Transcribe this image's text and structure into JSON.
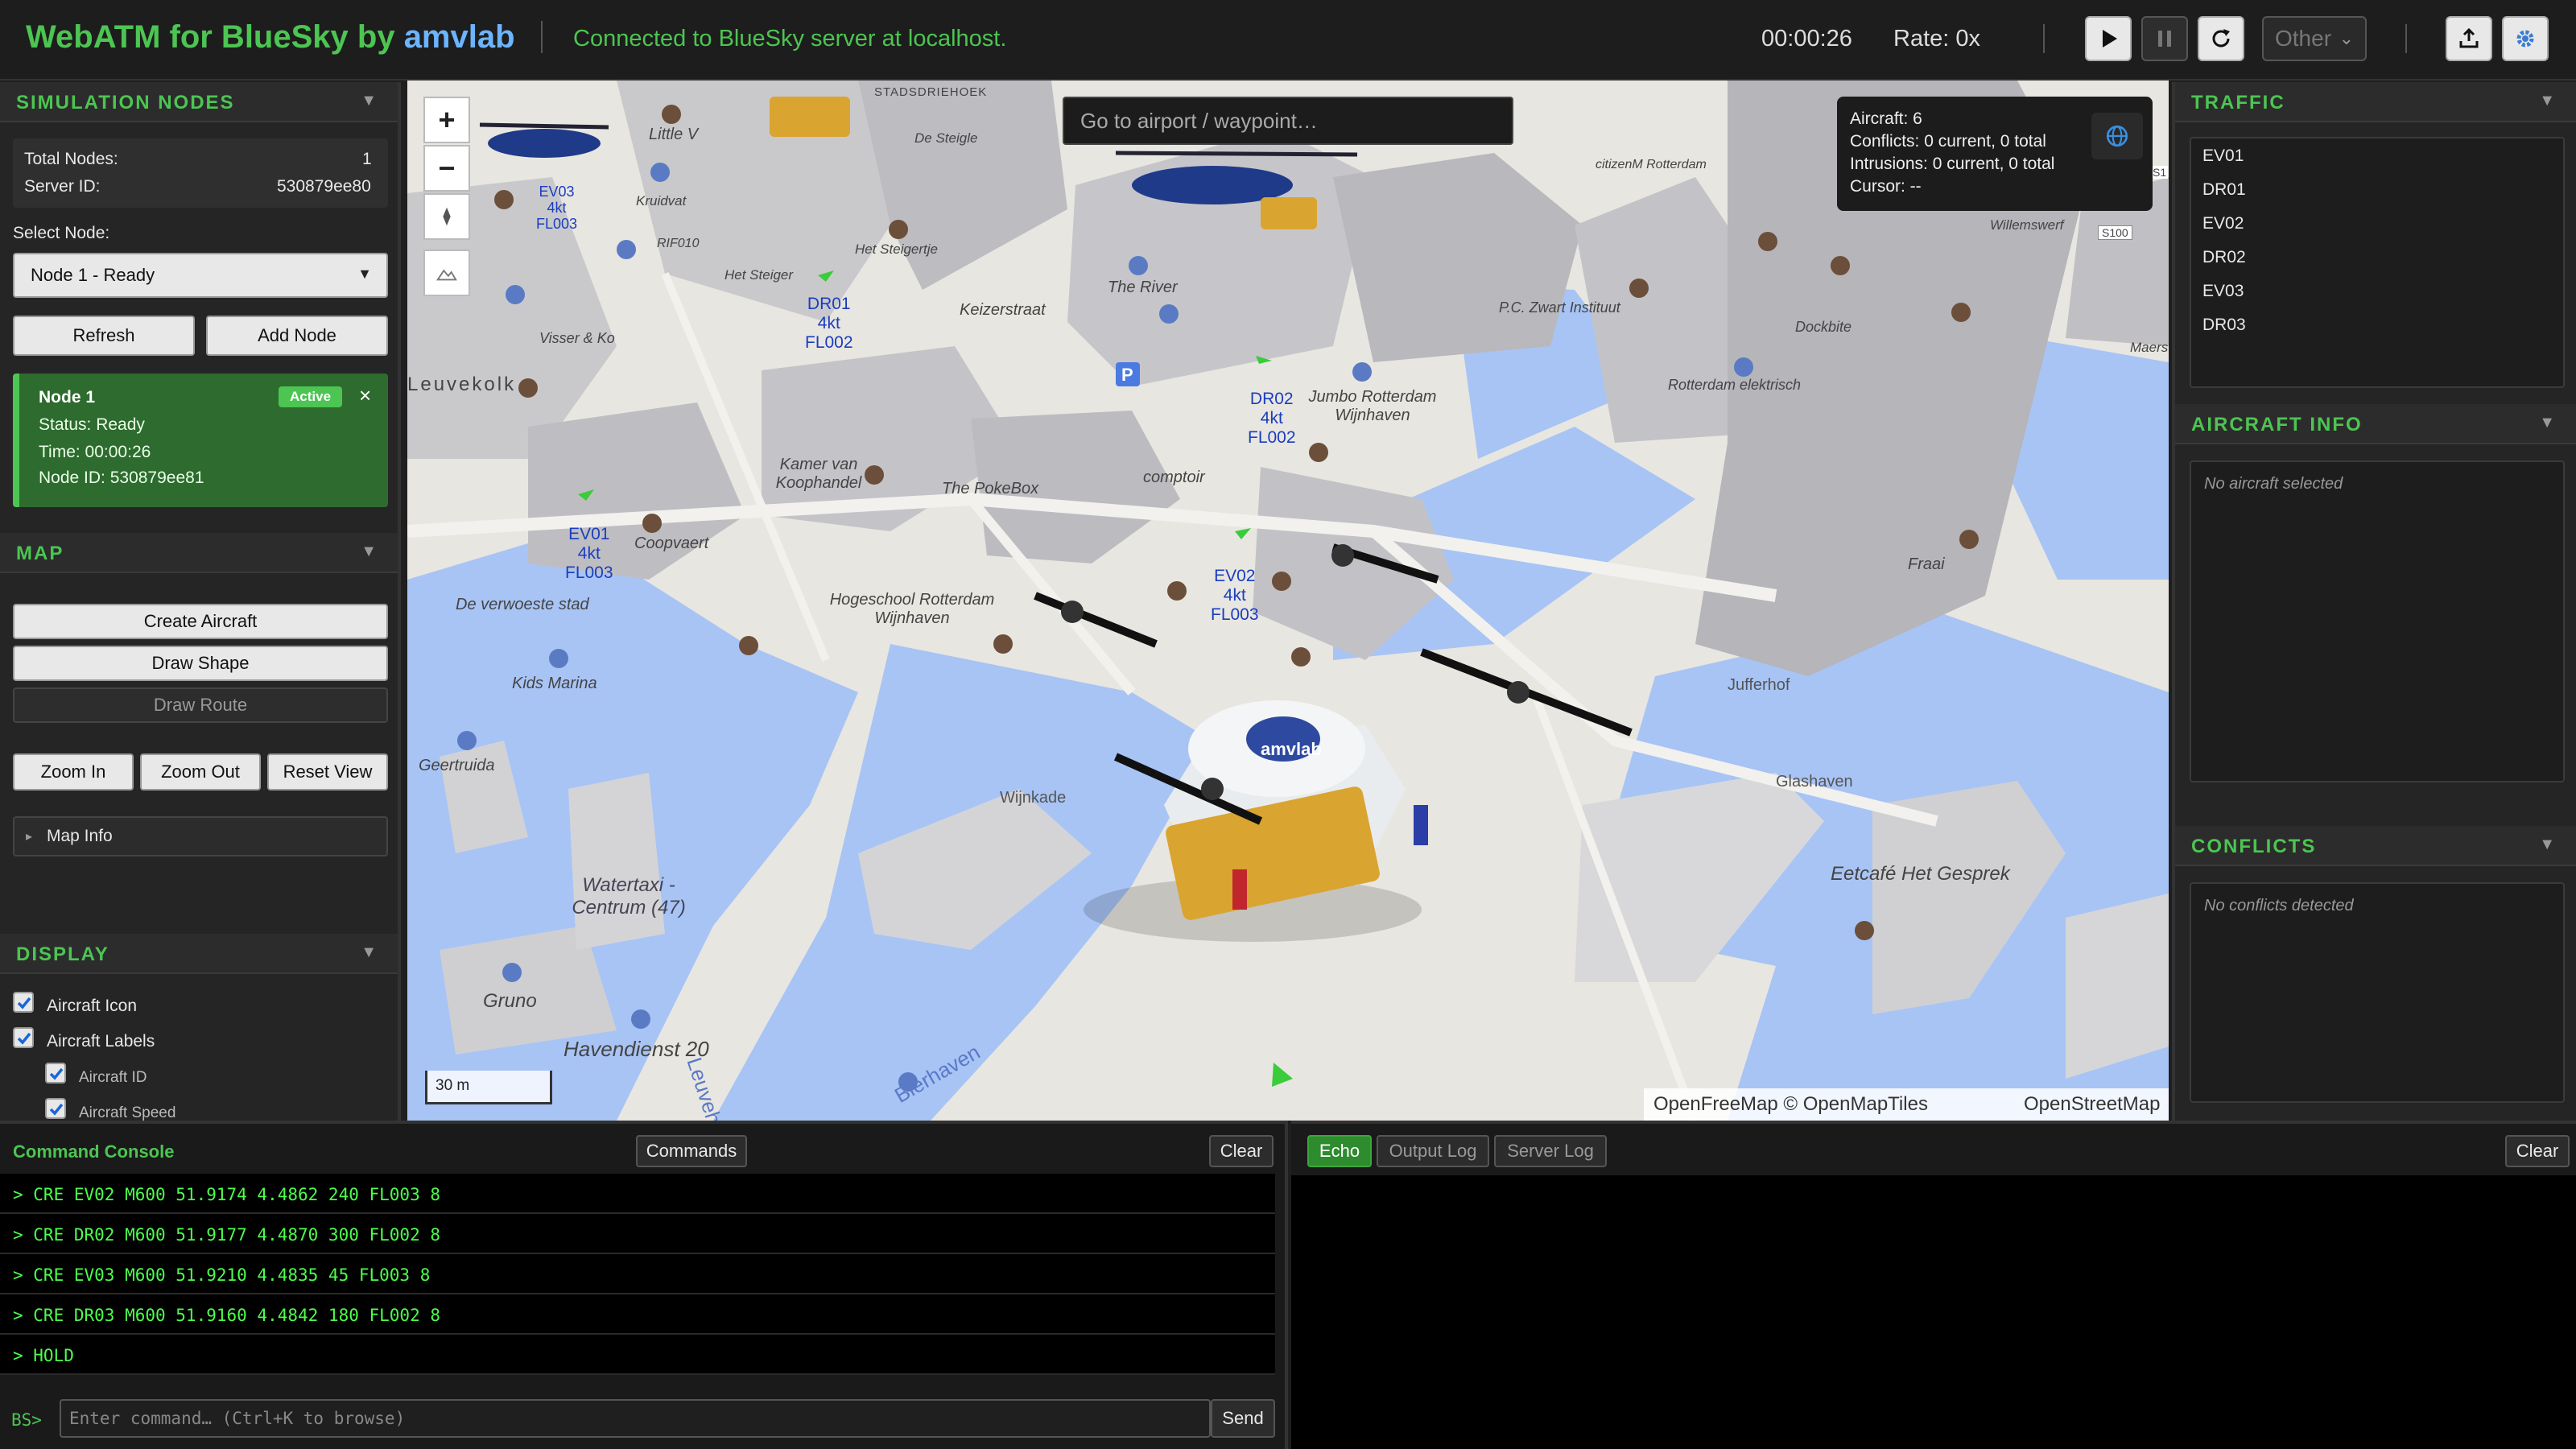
{
  "header": {
    "title_prefix": "WebATM for BlueSky by ",
    "title_brand": "amvlab",
    "connection_status": "Connected to BlueSky server at localhost.",
    "sim_time": "00:00:26",
    "rate": "Rate: 0x",
    "other_select": "Other"
  },
  "sim_nodes": {
    "section_title": "SIMULATION NODES",
    "total_nodes_label": "Total Nodes:",
    "total_nodes": "1",
    "server_id_label": "Server ID:",
    "server_id": "530879ee80",
    "select_label": "Select Node:",
    "selected_node": "Node 1 - Ready",
    "refresh_label": "Refresh",
    "add_label": "Add Node",
    "card": {
      "name": "Node 1",
      "badge": "Active",
      "close": "×",
      "status": "Status: Ready",
      "time": "Time: 00:00:26",
      "node_id": "Node ID: 530879ee81"
    }
  },
  "map_section": {
    "section_title": "MAP",
    "create_aircraft": "Create Aircraft",
    "draw_shape": "Draw Shape",
    "draw_route": "Draw Route",
    "zoom_in": "Zoom In",
    "zoom_out": "Zoom Out",
    "reset_view": "Reset View",
    "map_info": "Map Info"
  },
  "display": {
    "section_title": "DISPLAY",
    "options": [
      {
        "label": "Aircraft Icon",
        "checked": true
      },
      {
        "label": "Aircraft Labels",
        "checked": true
      },
      {
        "label": "Aircraft ID",
        "checked": true
      },
      {
        "label": "Aircraft Speed",
        "checked": true
      }
    ]
  },
  "map": {
    "search_placeholder": "Go to airport / waypoint…",
    "info": {
      "aircraft": "Aircraft: 6",
      "conflicts": "Conflicts: 0 current, 0 total",
      "intrusions": "Intrusions: 0 current, 0 total",
      "cursor": "Cursor: --"
    },
    "scale": "30 m",
    "attribution_a": "OpenFreeMap © OpenMapTiles",
    "attribution_b": "OpenStreetMap",
    "aircraft_labels": [
      {
        "id": "EV03",
        "speed": "4kt",
        "alt": "FL003"
      },
      {
        "id": "DR01",
        "speed": "4kt",
        "alt": "FL002"
      },
      {
        "id": "DR02",
        "speed": "4kt",
        "alt": "FL002"
      },
      {
        "id": "EV01",
        "speed": "4kt",
        "alt": "FL003"
      },
      {
        "id": "EV02",
        "speed": "4kt",
        "alt": "FL003"
      }
    ],
    "places": [
      "Little V",
      "Stadsdriehoek",
      "De Steigle",
      "Kruidvat",
      "RIF010",
      "Het Steiger",
      "Het Steigertje",
      "Keizerstraat",
      "The River",
      "Visser & Ko",
      "Leuvekolk",
      "Kamer van Koophandel",
      "The PokeBox",
      "comptoir",
      "Jumbo Rotterdam Wijnhaven",
      "P.C. Zwart Instituut",
      "Dockbite",
      "Rotterdam elektrisch",
      "Willemswerf",
      "citizenM Rotterdam",
      "Coopvaert",
      "De verwoeste stad",
      "Hogeschool Rotterdam Wijnhaven",
      "Kids Marina",
      "Geertruida",
      "Glashaven",
      "Jufferhof",
      "Fraai",
      "Wijnkade",
      "Eetcafé Het Gesprek",
      "Watertaxi - Centrum (47)",
      "Gruno",
      "Havendienst 20",
      "Leuvehaven",
      "Bierhaven",
      "Maers",
      "S100",
      "S1"
    ]
  },
  "traffic": {
    "section_title": "TRAFFIC",
    "items": [
      "EV01",
      "DR01",
      "EV02",
      "DR02",
      "EV03",
      "DR03"
    ]
  },
  "aircraft_info": {
    "section_title": "AIRCRAFT INFO",
    "empty": "No aircraft selected"
  },
  "conflicts": {
    "section_title": "CONFLICTS",
    "empty": "No conflicts detected"
  },
  "console": {
    "title": "Command Console",
    "commands_btn": "Commands",
    "clear_btn": "Clear",
    "lines": [
      "> CRE EV02 M600 51.9174 4.4862 240 FL003 8",
      "> CRE DR02 M600 51.9177 4.4870 300 FL002 8",
      "> CRE EV03 M600 51.9210 4.4835 45 FL003 8",
      "> CRE DR03 M600 51.9160 4.4842 180 FL002 8",
      "> HOLD"
    ],
    "prompt": "BS>",
    "input_placeholder": "Enter command… (Ctrl+K to browse)",
    "send_btn": "Send"
  },
  "output": {
    "tabs": [
      "Echo",
      "Output Log",
      "Server Log"
    ],
    "active_tab": "Echo",
    "clear_btn": "Clear"
  },
  "colors": {
    "accent_green": "#4cc552",
    "brand_blue": "#6cb4ff",
    "map_water": "#a8c4f5",
    "aircraft_label": "#1a3dbf"
  }
}
